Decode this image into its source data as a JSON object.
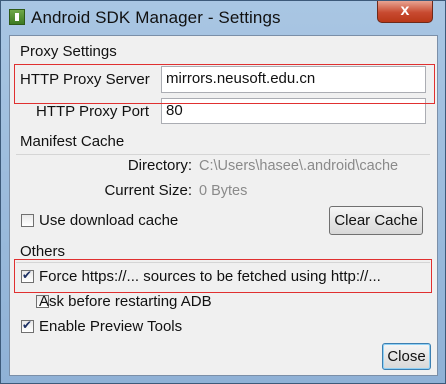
{
  "window": {
    "title": "Android SDK Manager - Settings",
    "close_glyph": "x"
  },
  "proxy": {
    "section_title": "Proxy Settings",
    "server_label": "HTTP Proxy Server",
    "server_value": "mirrors.neusoft.edu.cn",
    "port_label": "HTTP Proxy Port",
    "port_value": "80"
  },
  "manifest": {
    "section_title": "Manifest Cache",
    "directory_label": "Directory:",
    "directory_value": "C:\\Users\\hasee\\.android\\cache",
    "size_label": "Current Size:",
    "size_value": "0 Bytes",
    "use_cache_label": "Use download cache",
    "use_cache_checked": false,
    "clear_cache_button": "Clear Cache"
  },
  "others": {
    "section_title": "Others",
    "force_https_label": "Force https://... sources to be fetched using http://...",
    "force_https_checked": true,
    "ask_restart_label": "Ask before restarting ADB",
    "ask_restart_checked": false,
    "preview_tools_label": "Enable Preview Tools",
    "preview_tools_checked": true
  },
  "footer": {
    "close_button": "Close"
  },
  "colors": {
    "highlight_box": "#e03030",
    "window_frame": "#a9c6e3"
  }
}
